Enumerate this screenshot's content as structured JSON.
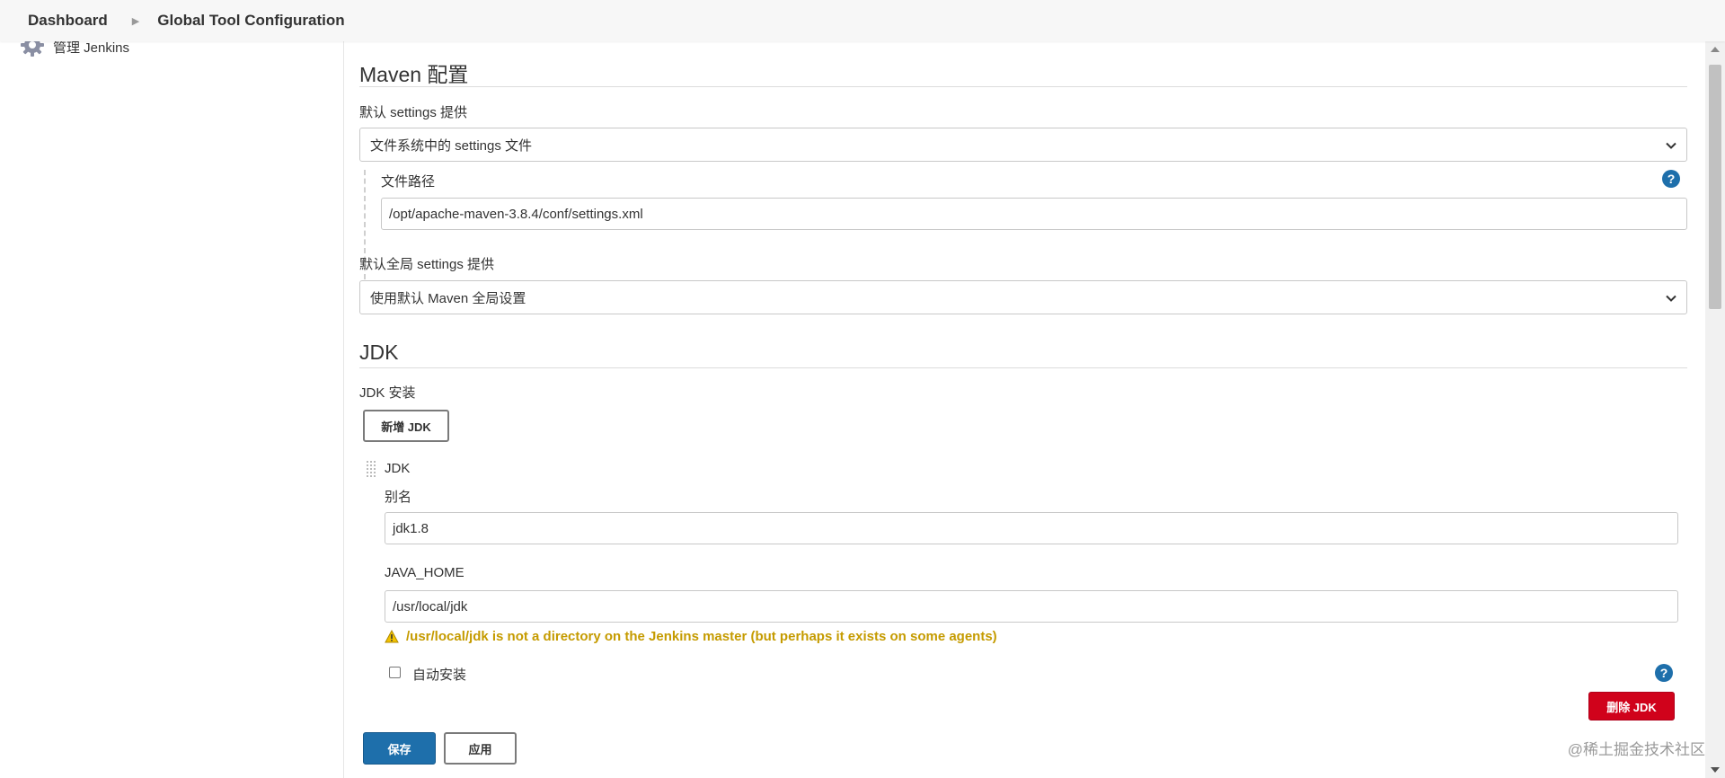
{
  "breadcrumb": {
    "items": [
      "Dashboard",
      "Global Tool Configuration"
    ]
  },
  "sidebar": {
    "items": [
      {
        "label": "管理 Jenkins",
        "icon": "gear-icon"
      }
    ]
  },
  "maven": {
    "title": "Maven 配置",
    "settings_label": "默认 settings 提供",
    "settings_value": "文件系统中的 settings 文件",
    "file_path_label": "文件路径",
    "file_path_value": "/opt/apache-maven-3.8.4/conf/settings.xml",
    "global_settings_label": "默认全局 settings 提供",
    "global_settings_value": "使用默认 Maven 全局设置"
  },
  "jdk": {
    "title": "JDK",
    "install_label": "JDK 安装",
    "add_button": "新增 JDK",
    "item_header": "JDK",
    "alias_label": "别名",
    "alias_value": "jdk1.8",
    "java_home_label": "JAVA_HOME",
    "java_home_value": "/usr/local/jdk",
    "warning": "/usr/local/jdk is not a directory on the Jenkins master (but perhaps it exists on some agents)",
    "auto_install_label": "自动安装",
    "auto_install_checked": false,
    "delete_button": "删除 JDK"
  },
  "footer": {
    "save_button": "保存",
    "apply_button": "应用"
  },
  "watermark": "@稀土掘金技术社区",
  "colors": {
    "primary": "#1e6fab",
    "danger": "#d0021b",
    "warning": "#c59b00"
  }
}
